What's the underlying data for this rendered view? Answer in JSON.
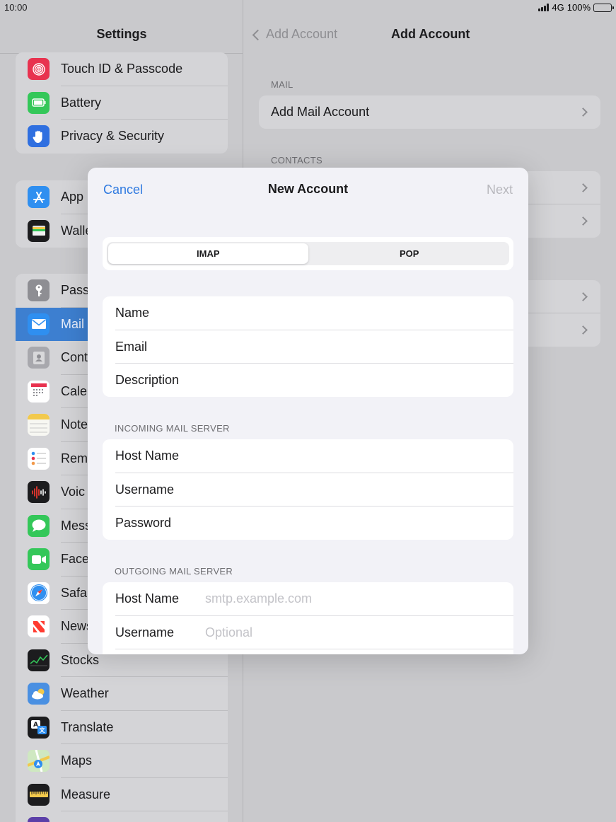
{
  "status": {
    "time": "10:00",
    "network": "4G",
    "battery": "100%"
  },
  "sidebar": {
    "title": "Settings",
    "groups": [
      [
        {
          "label": "Touch ID & Passcode",
          "icon": "touch-id-icon",
          "color": "#e8324f"
        },
        {
          "label": "Battery",
          "icon": "battery-icon",
          "color": "#34c759"
        },
        {
          "label": "Privacy & Security",
          "icon": "hand-icon",
          "color": "#2f6fe0"
        }
      ],
      [
        {
          "label": "App",
          "icon": "app-store-icon",
          "color": "#2f8ff0"
        },
        {
          "label": "Walle",
          "icon": "wallet-icon",
          "color": "#1c1c1e"
        }
      ],
      [
        {
          "label": "Pass",
          "icon": "key-icon",
          "color": "#8e8e93"
        },
        {
          "label": "Mail",
          "icon": "mail-icon",
          "color": "#2f8ff0",
          "selected": true
        },
        {
          "label": "Cont",
          "icon": "contacts-icon",
          "color": "#a8a8ad"
        },
        {
          "label": "Cale",
          "icon": "calendar-icon",
          "color": "#ffffff"
        },
        {
          "label": "Note",
          "icon": "notes-icon",
          "color": "#f2c94c"
        },
        {
          "label": "Rem",
          "icon": "reminders-icon",
          "color": "#ffffff"
        },
        {
          "label": "Voic",
          "icon": "voice-memos-icon",
          "color": "#1c1c1e"
        },
        {
          "label": "Mess",
          "icon": "messages-icon",
          "color": "#34c759"
        },
        {
          "label": "Face",
          "icon": "facetime-icon",
          "color": "#34c759"
        },
        {
          "label": "Safa",
          "icon": "safari-icon",
          "color": "#2f8ff0"
        },
        {
          "label": "News",
          "icon": "news-icon",
          "color": "#ffffff"
        },
        {
          "label": "Stocks",
          "icon": "stocks-icon",
          "color": "#1c1c1e"
        },
        {
          "label": "Weather",
          "icon": "weather-icon",
          "color": "#4a90e2"
        },
        {
          "label": "Translate",
          "icon": "translate-icon",
          "color": "#1c1c1e"
        },
        {
          "label": "Maps",
          "icon": "maps-icon",
          "color": "#6fcf97"
        },
        {
          "label": "Measure",
          "icon": "measure-icon",
          "color": "#1c1c1e"
        }
      ]
    ]
  },
  "detail": {
    "back_label": "Add Account",
    "title": "Add Account",
    "mail_section": "MAIL",
    "add_mail_label": "Add Mail Account",
    "contacts_section": "CONTACTS"
  },
  "modal": {
    "cancel": "Cancel",
    "title": "New Account",
    "next": "Next",
    "segments": [
      "IMAP",
      "POP"
    ],
    "selected_segment": "IMAP",
    "account_fields": [
      "Name",
      "Email",
      "Description"
    ],
    "incoming_section": "INCOMING MAIL SERVER",
    "incoming_fields": [
      "Host Name",
      "Username",
      "Password"
    ],
    "outgoing_section": "OUTGOING MAIL SERVER",
    "outgoing_fields": [
      {
        "label": "Host Name",
        "placeholder": "smtp.example.com"
      },
      {
        "label": "Username",
        "placeholder": "Optional"
      }
    ]
  }
}
